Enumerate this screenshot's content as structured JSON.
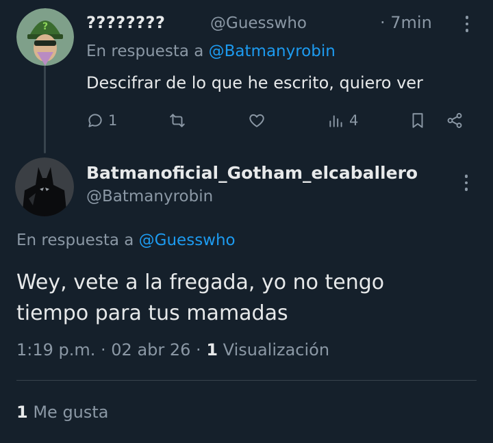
{
  "colors": {
    "background": "#15202b",
    "text": "#e7e9ea",
    "muted": "#8b98a5",
    "link": "#1d9bf0",
    "divider": "#38444d"
  },
  "reply_tweet": {
    "display_name": "????????",
    "handle": "@Guesswho",
    "time": "· 7min",
    "in_reply_prefix": "En respuesta a",
    "in_reply_handle": "@Batmanyrobin",
    "text": "Descifrar de lo que he escrito, quiero ver",
    "avatar_icon": "riddler-avatar",
    "actions": {
      "reply_icon": "reply-icon",
      "reply_count": "1",
      "retweet_icon": "retweet-icon",
      "like_icon": "heart-icon",
      "views_icon": "views-icon",
      "views_count": "4",
      "bookmark_icon": "bookmark-icon",
      "share_icon": "share-icon"
    }
  },
  "main_tweet": {
    "display_name": "Batmanoficial_Gotham_elcaballero",
    "handle": "@Batmanyrobin",
    "avatar_icon": "batman-avatar",
    "in_reply_prefix": "En respuesta a",
    "in_reply_handle": "@Guesswho",
    "text_line1": "Wey, vete a la fregada, yo no tengo",
    "text_line2": "tiempo para tus mamadas",
    "meta_time": "1:19 p.m. · 02 abr 26 ·",
    "meta_views_count": "1",
    "meta_views_label": "Visualización",
    "likes_count": "1",
    "likes_label": "Me gusta"
  }
}
